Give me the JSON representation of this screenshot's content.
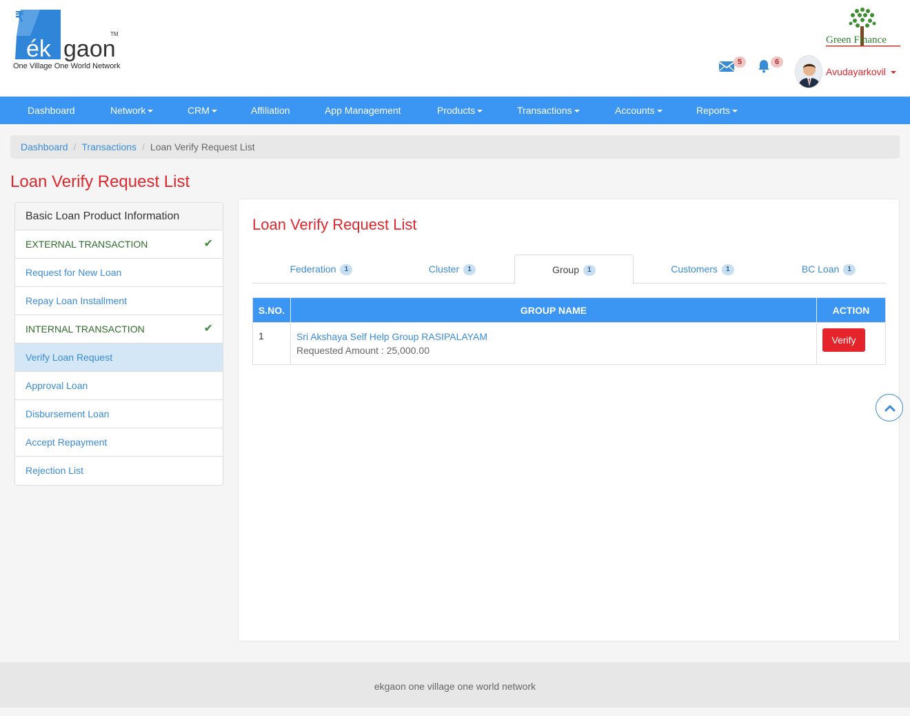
{
  "brand": {
    "logo_text_ek": "ék",
    "logo_text_gaon": "gaon",
    "logo_tm": "TM",
    "logo_symbol": "₹",
    "tagline": "One Village One World Network",
    "partner_name": "Green Finance"
  },
  "header": {
    "mail_count": "5",
    "notification_count": "6",
    "user_name": "Avudayarkovil"
  },
  "nav": {
    "items": [
      {
        "label": "Dashboard"
      },
      {
        "label": "Network"
      },
      {
        "label": "CRM"
      },
      {
        "label": "Affiliation"
      },
      {
        "label": "App Management"
      },
      {
        "label": "Products"
      },
      {
        "label": "Transactions"
      },
      {
        "label": "Accounts"
      },
      {
        "label": "Reports"
      }
    ]
  },
  "breadcrumb": {
    "items": [
      "Dashboard",
      "Transactions",
      "Loan Verify Request List"
    ]
  },
  "page": {
    "title": "Loan Verify Request List"
  },
  "sidebar": {
    "heading": "Basic Loan Product Information",
    "items": [
      {
        "label": "EXTERNAL TRANSACTION"
      },
      {
        "label": "Request for New Loan"
      },
      {
        "label": "Repay Loan Installment"
      },
      {
        "label": "INTERNAL TRANSACTION"
      },
      {
        "label": "Verify Loan Request"
      },
      {
        "label": "Approval Loan"
      },
      {
        "label": "Disbursement Loan"
      },
      {
        "label": "Accept Repayment"
      },
      {
        "label": "Rejection List"
      }
    ],
    "check_glyph": "✔"
  },
  "panel": {
    "title": "Loan Verify Request List",
    "tabs": [
      {
        "label": "Federation",
        "count": "1"
      },
      {
        "label": "Cluster",
        "count": "1"
      },
      {
        "label": "Group",
        "count": "1"
      },
      {
        "label": "Customers",
        "count": "1"
      },
      {
        "label": "BC Loan",
        "count": "1"
      }
    ],
    "active_tab": "Group",
    "table": {
      "headers": [
        "S.NO.",
        "GROUP NAME",
        "ACTION"
      ],
      "rows": [
        {
          "sno": "1",
          "group_name": "Sri Akshaya Self Help Group RASIPALAYAM",
          "requested_amount": "Requested Amount : 25,000.00",
          "action": "Verify"
        }
      ]
    }
  },
  "footer": {
    "text": "ekgaon one village one world network"
  },
  "colors": {
    "primary": "#3a95f3",
    "accent_red": "#e0262d",
    "link": "#3a8bd6",
    "section_green": "#2e6b2a"
  },
  "icons": {
    "mail": "envelope-icon",
    "notifications": "bell-icon",
    "scroll_top": "chevron-up-icon"
  }
}
